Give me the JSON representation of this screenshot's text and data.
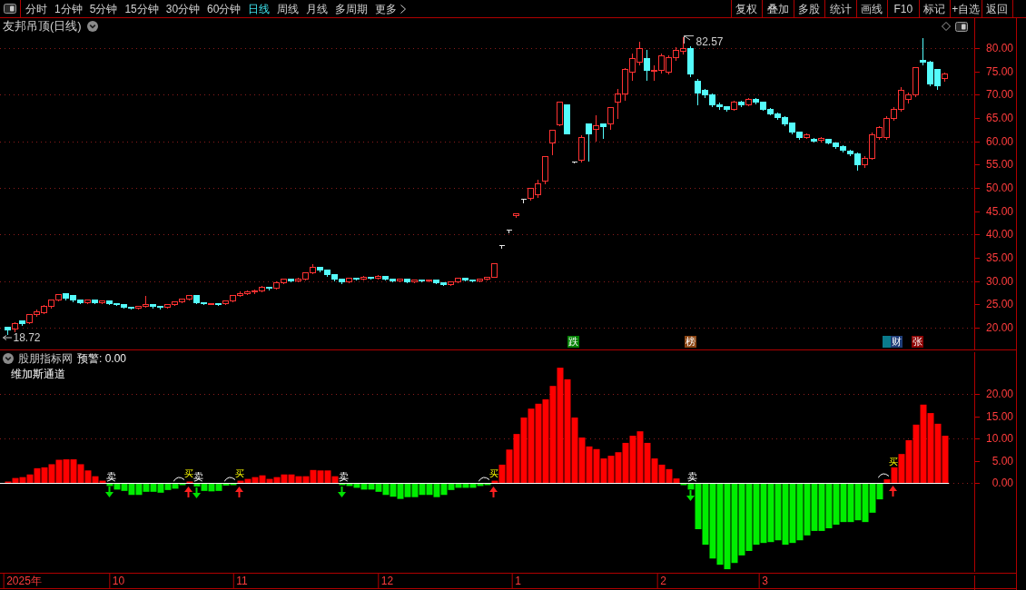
{
  "toolbar": {
    "periods": [
      {
        "label": "分时",
        "selected": false
      },
      {
        "label": "1分钟",
        "selected": false
      },
      {
        "label": "5分钟",
        "selected": false
      },
      {
        "label": "15分钟",
        "selected": false
      },
      {
        "label": "30分钟",
        "selected": false
      },
      {
        "label": "60分钟",
        "selected": false
      },
      {
        "label": "日线",
        "selected": true
      },
      {
        "label": "周线",
        "selected": false
      },
      {
        "label": "月线",
        "selected": false
      },
      {
        "label": "多周期",
        "selected": false
      }
    ],
    "more": {
      "label": "更多"
    },
    "buttons": [
      "复权",
      "叠加",
      "多股",
      "统计",
      "画线",
      "F10",
      "标记",
      "+自选",
      "返回"
    ]
  },
  "price_panel": {
    "title": "友邦吊顶(日线)",
    "axis_labels": [
      "80.00",
      "75.00",
      "70.00",
      "65.00",
      "60.00",
      "55.00",
      "50.00",
      "45.00",
      "40.00",
      "35.00",
      "30.00",
      "25.00",
      "20.00"
    ],
    "high_label": "82.57",
    "low_label": "18.72",
    "event_tags": [
      {
        "label": "跌",
        "color": "#008000"
      },
      {
        "label": "榜",
        "color": "#8b4513"
      },
      {
        "color": "#0a7a8c"
      },
      {
        "label": "财",
        "color": "#1e3c78"
      },
      {
        "label": "张",
        "color": "#8b0000"
      }
    ]
  },
  "indicator_panel": {
    "name": "股朋指标网",
    "alert": "预警: 0.00",
    "line_label": "维加斯通道",
    "chart_data": {
      "type": "bar",
      "grid": true,
      "categories": [
        null,
        null,
        "2025年",
        null,
        null,
        null,
        null,
        null,
        null,
        null,
        null,
        null,
        null,
        null,
        null,
        "10",
        null,
        null,
        null,
        null,
        null,
        null,
        null,
        null,
        null,
        null,
        null,
        null,
        null,
        null,
        null,
        null,
        "11",
        null,
        null,
        null,
        null,
        null,
        null,
        null,
        null,
        null,
        null,
        null,
        null,
        null,
        null,
        null,
        null,
        null,
        null,
        null,
        "12",
        null,
        null,
        null,
        null,
        null,
        null,
        null,
        null,
        null,
        null,
        null,
        null,
        null,
        null,
        null,
        null,
        null,
        "1",
        null,
        null,
        null,
        null,
        null,
        null,
        null,
        null,
        null,
        null,
        null,
        null,
        null,
        null,
        null,
        null,
        null,
        null,
        null,
        "2",
        null,
        null,
        null,
        null,
        null,
        null,
        null,
        null,
        null,
        null,
        null,
        null,
        null,
        "3",
        null,
        null,
        null,
        null,
        null,
        null,
        null,
        null,
        null,
        null,
        null,
        null,
        null,
        null,
        null,
        null,
        null,
        null,
        null,
        null,
        null,
        null,
        null,
        null,
        null
      ],
      "values": [
        0.3,
        1.1,
        1.3,
        1.9,
        3.3,
        3.5,
        4.2,
        5.2,
        5.3,
        5.3,
        4.2,
        2.8,
        1.5,
        0.5,
        -0.7,
        -1.5,
        -1.8,
        -2.7,
        -2.7,
        -2.0,
        -2.0,
        -2.2,
        -1.6,
        -1.3,
        -0.5,
        0.2,
        -0.8,
        -1.8,
        -1.9,
        -1.8,
        -0.6,
        -0.3,
        0.5,
        0.9,
        1.3,
        1.7,
        0.9,
        1.3,
        1.9,
        1.9,
        1.5,
        1.5,
        2.9,
        2.8,
        2.8,
        1.5,
        -0.5,
        -0.7,
        -1.1,
        -1.5,
        -1.5,
        -2.0,
        -2.7,
        -3.1,
        -3.6,
        -3.2,
        -3.2,
        -2.7,
        -2.7,
        -3.2,
        -2.7,
        -1.6,
        -1.1,
        -1.1,
        -1.1,
        -0.7,
        -0.5,
        0.5,
        4.1,
        7.5,
        11,
        14.7,
        16.7,
        17.8,
        18.8,
        21.8,
        25.9,
        23.3,
        14.7,
        10.2,
        8.2,
        7.6,
        5.5,
        6.1,
        6.9,
        9.0,
        10.6,
        11.6,
        9.0,
        5.5,
        4.1,
        3.1,
        1.0,
        -0.5,
        -1.5,
        -10.4,
        -13.9,
        -17,
        -18.4,
        -19.4,
        -18,
        -16.3,
        -15.3,
        -13.9,
        -13.5,
        -13.3,
        -12.9,
        -13.9,
        -13.5,
        -12.9,
        -11.8,
        -10.8,
        -10.8,
        -10.2,
        -9.4,
        -8.8,
        -8.8,
        -8.4,
        -8.8,
        -6.7,
        -3.7,
        0.8,
        3.5,
        6.5,
        9.6,
        13.1,
        17.6,
        15.7,
        13.3,
        10.6
      ],
      "ylim": [
        -20.2,
        29.8
      ],
      "yticks": [
        {
          "value": 20,
          "label": "20.00"
        },
        {
          "value": 15,
          "label": "15.00"
        },
        {
          "value": 10,
          "label": "10.00"
        },
        {
          "value": 5,
          "label": "5.00"
        },
        {
          "value": 0,
          "label": "0.00"
        }
      ],
      "annotations": [
        "卖",
        "买",
        "卖",
        "买",
        "卖",
        "买",
        "卖",
        "买"
      ]
    }
  }
}
